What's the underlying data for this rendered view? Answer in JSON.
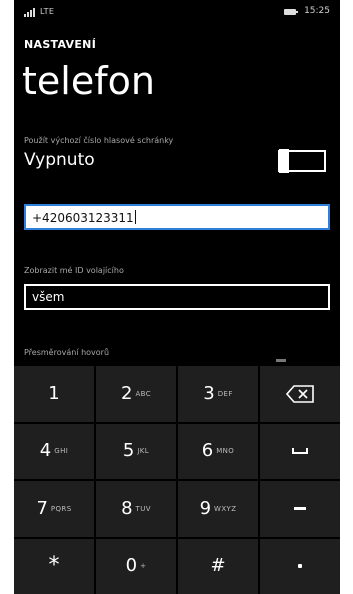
{
  "status": {
    "network": "LTE",
    "time": "15:25"
  },
  "header": {
    "app_name": "NASTAVENÍ",
    "title": "telefon"
  },
  "voicemail": {
    "label": "Použít výchozí číslo hlasové schránky",
    "value": "Vypnuto"
  },
  "number_field": {
    "value": "+420603123311"
  },
  "caller_id": {
    "label": "Zobrazit mé ID volajícího",
    "value": "všem"
  },
  "forwarding": {
    "label": "Přesměrování hovorů"
  },
  "keypad": {
    "keys": [
      {
        "digit": "1",
        "letters": ""
      },
      {
        "digit": "2",
        "letters": "ABC"
      },
      {
        "digit": "3",
        "letters": "DEF"
      },
      {
        "digit": "4",
        "letters": "GHI"
      },
      {
        "digit": "5",
        "letters": "JKL"
      },
      {
        "digit": "6",
        "letters": "MNO"
      },
      {
        "digit": "7",
        "letters": "PQRS"
      },
      {
        "digit": "8",
        "letters": "TUV"
      },
      {
        "digit": "9",
        "letters": "WXYZ"
      },
      {
        "digit": "*",
        "letters": ""
      },
      {
        "digit": "0",
        "letters": "+"
      },
      {
        "digit": "#",
        "letters": ""
      }
    ]
  }
}
